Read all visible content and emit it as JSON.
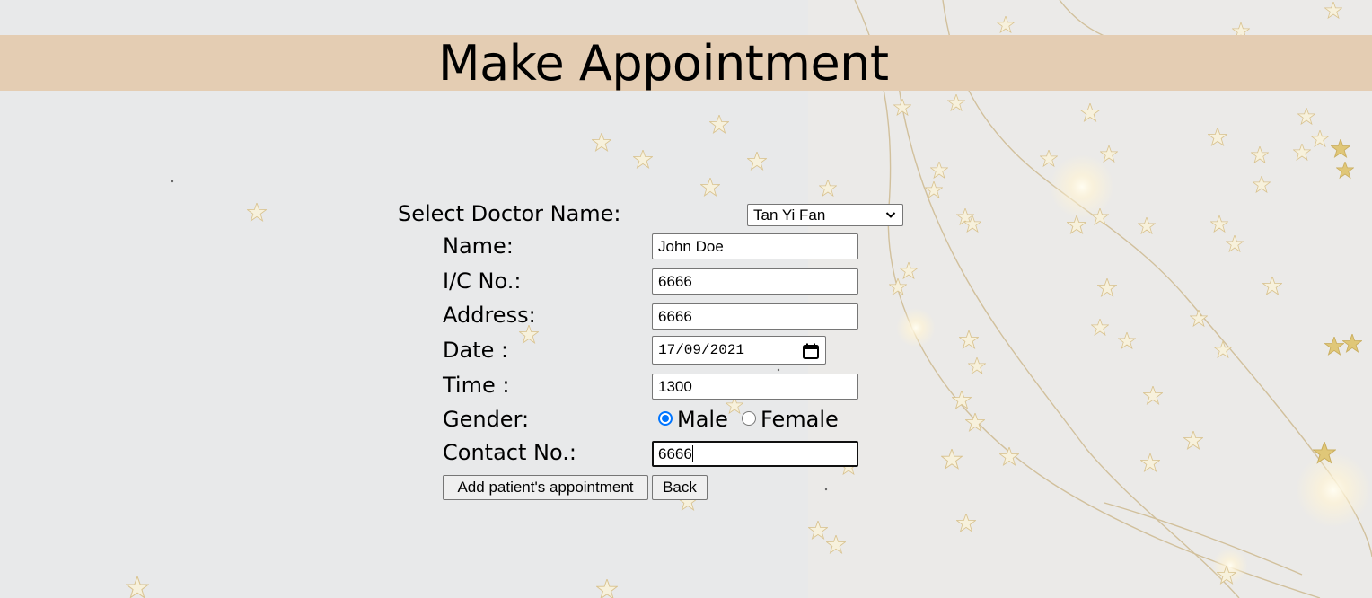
{
  "page": {
    "title": "Make Appointment",
    "banner_color": "#e4cdb3",
    "background_theme": "stars-and-fairy-lights"
  },
  "form": {
    "doctor": {
      "label": "Select Doctor Name:",
      "selected": "Tan Yi Fan"
    },
    "name": {
      "label": "Name:",
      "value": "John Doe"
    },
    "ic": {
      "label": "I/C No.:",
      "value": "6666"
    },
    "address": {
      "label": "Address:",
      "value": "6666"
    },
    "date": {
      "label": "Date :",
      "value": "17/09/2021"
    },
    "time": {
      "label": "Time :",
      "value": "1300"
    },
    "gender": {
      "label": "Gender:",
      "options": [
        "Male",
        "Female"
      ],
      "selected": "Male"
    },
    "contact": {
      "label": "Contact No.:",
      "value": "6666"
    }
  },
  "buttons": {
    "add": "Add patient's appointment",
    "back": "Back"
  },
  "colors": {
    "radio_accent": "#0075ff"
  }
}
